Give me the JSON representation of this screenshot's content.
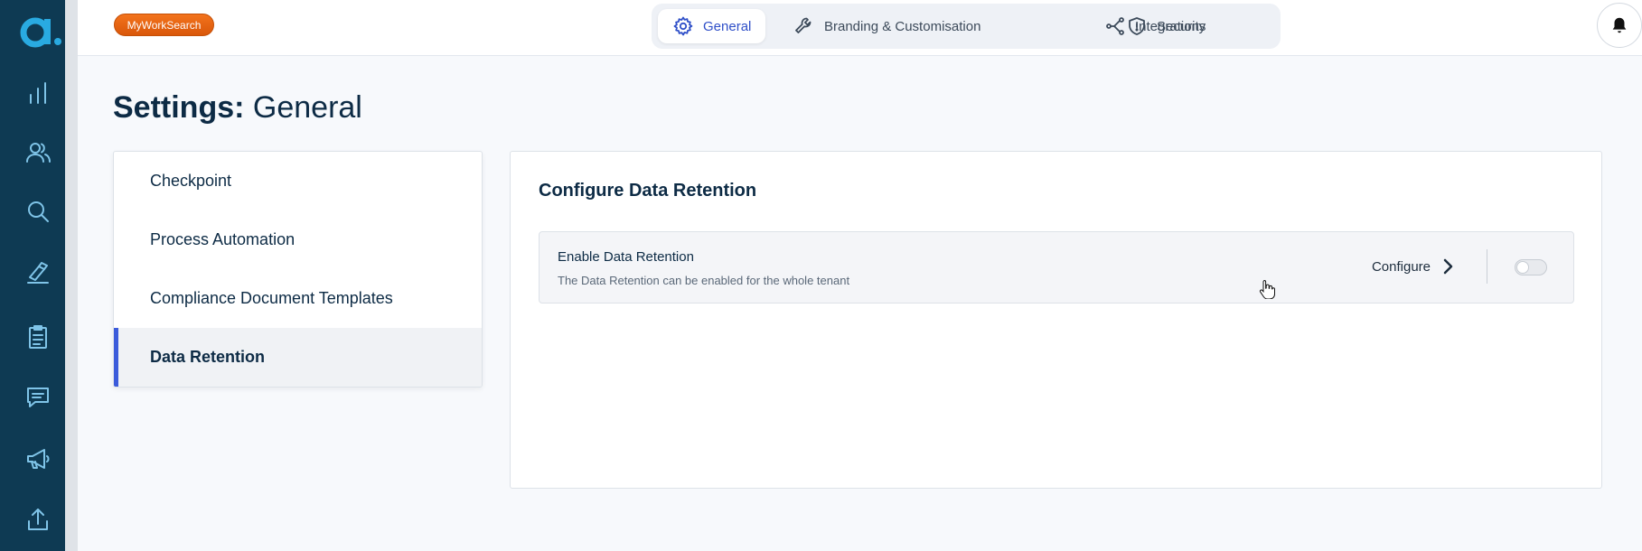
{
  "brand": {
    "badge_text": "MyWorkSearch",
    "badge_color": "#e8620f",
    "logo_color": "#29aae1"
  },
  "rail": {
    "items": [
      "analytics-icon",
      "users-icon",
      "search-icon",
      "pen-icon",
      "clipboard-icon",
      "chat-icon",
      "megaphone-icon",
      "upload-icon"
    ]
  },
  "nav": {
    "tabs": [
      {
        "label": "General",
        "icon": "gear-icon",
        "active": true
      },
      {
        "label": "Branding & Customisation",
        "icon": "wrench-icon",
        "active": false
      },
      {
        "label": "Integrations",
        "icon": "integrations-icon",
        "active": false
      },
      {
        "label": "Security",
        "icon": "shield-icon",
        "active": false
      }
    ]
  },
  "page": {
    "title_bold": "Settings:",
    "title_light": "General"
  },
  "side_menu": {
    "items": [
      {
        "label": "Checkpoint",
        "active": false
      },
      {
        "label": "Process Automation",
        "active": false
      },
      {
        "label": "Compliance Document Templates",
        "active": false
      },
      {
        "label": "Data Retention",
        "active": true
      }
    ]
  },
  "content": {
    "title": "Configure Data Retention",
    "setting": {
      "name": "Enable Data Retention",
      "description": "The Data Retention can be enabled for the whole tenant",
      "configure_label": "Configure",
      "enabled": false
    }
  },
  "colors": {
    "rail": "#0e3a53",
    "accent": "#3b5bdb",
    "text": "#0d2b45"
  }
}
